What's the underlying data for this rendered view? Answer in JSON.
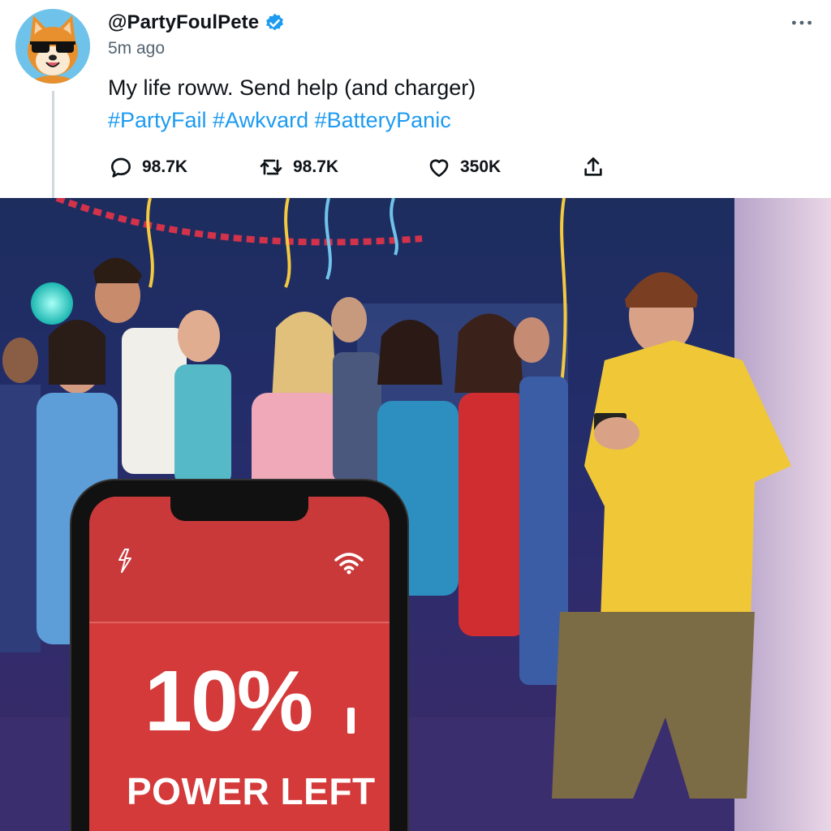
{
  "tweet": {
    "handle": "@PartyFoulPete",
    "timestamp": "5m ago",
    "text_line1": "My life roww. Send help (and charger)",
    "hashtags": "#PartyFail #Awkvard #BatteryPanic",
    "more_icon": "more-dots-icon",
    "actions": {
      "reply_count": "98.7K",
      "retweet_count": "98.7K",
      "like_count": "350K"
    },
    "colors": {
      "link": "#1d9bf0",
      "verified": "#1d9bf0",
      "muted": "#536471"
    }
  },
  "photo": {
    "phone": {
      "battery_percent": "10%",
      "label": "POWER LEFT",
      "screen_color": "#d43a3a",
      "icons": [
        "lightning-bolt-icon",
        "wifi-icon"
      ]
    }
  }
}
